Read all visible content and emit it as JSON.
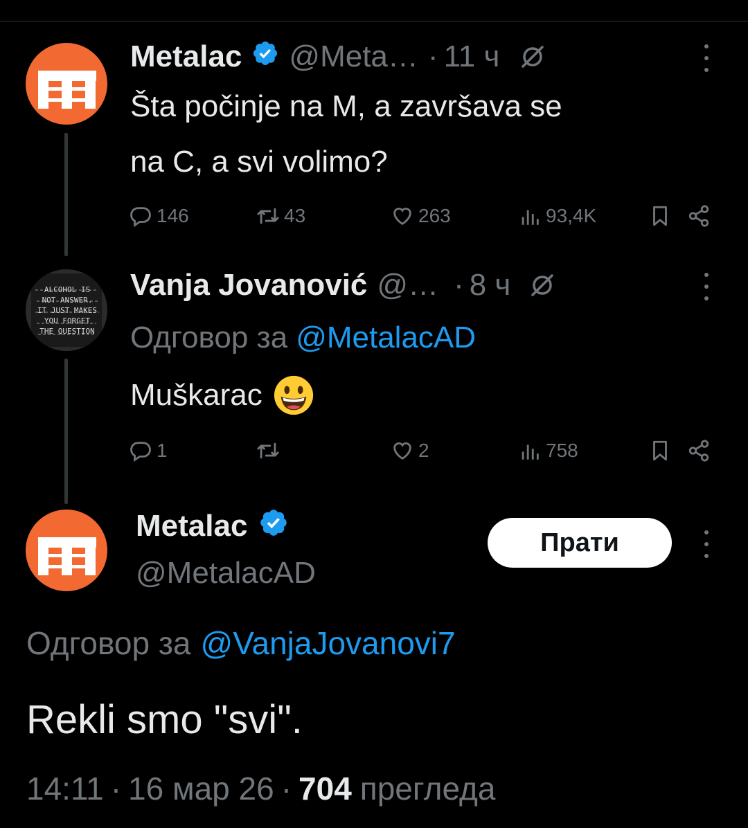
{
  "tweet1": {
    "name": "Metalac",
    "handle": "@Meta…",
    "dot": "·",
    "time": "11 ч",
    "text_line1": "Šta počinje na M, a završava se",
    "text_line2": "na C, a svi volimo?",
    "replies": "146",
    "retweets": "43",
    "likes": "263",
    "views": "93,4K"
  },
  "tweet2": {
    "name": "Vanja Jovanović",
    "handle": "@…",
    "dot": "·",
    "time": "8 ч",
    "reply_to_prefix": "Одговор за",
    "reply_to_handle": "@MetalacAD",
    "text": "Muškarac",
    "emoji": "😀",
    "replies": "1",
    "retweets": "",
    "likes": "2",
    "views": "758",
    "avatar_text": [
      "ALCOHOL IS",
      "NOT ANSWER.",
      "IT JUST MAKES",
      "YOU FORGET",
      "THE QUESTION"
    ]
  },
  "main": {
    "name": "Metalac",
    "handle": "@MetalacAD",
    "follow_label": "Прати",
    "reply_to_prefix": "Одговор за",
    "reply_to_handle": "@VanjaJovanovi7",
    "text": "Rekli smo \"svi\".",
    "time": "14:11",
    "dot": "·",
    "date": "16 мар 26",
    "views_count": "704",
    "views_label": "прегледа"
  },
  "colors": {
    "background": "#000000",
    "text": "#e7e9ea",
    "muted": "#71767b",
    "link": "#1d9bf0",
    "brand": "#f26a32",
    "verified": "#1d9bf0"
  },
  "icons": [
    "metalac-logo-icon",
    "verified-badge-icon",
    "grok-icon",
    "more-icon",
    "reply-icon",
    "retweet-icon",
    "like-icon",
    "views-icon",
    "bookmark-icon",
    "share-icon"
  ]
}
